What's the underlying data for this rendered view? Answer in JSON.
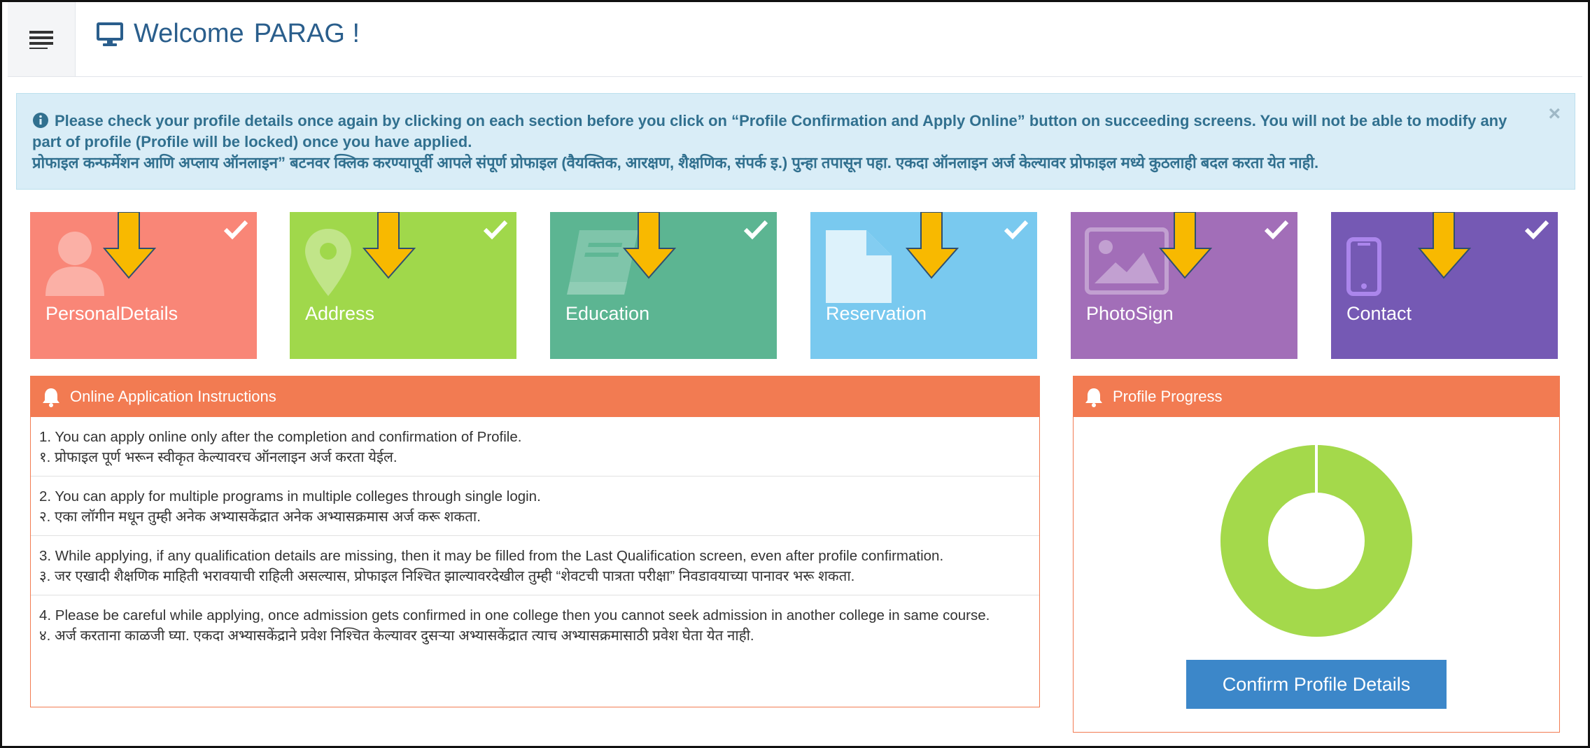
{
  "header": {
    "menu_icon": "hamburger-icon",
    "monitor_icon": "desktop-icon",
    "welcome_prefix": "Welcome",
    "user_name": "PARAG !"
  },
  "alert": {
    "icon": "info-circle-icon",
    "english_text": "Please check your profile details once again by clicking on each section before you click on “Profile Confirmation and Apply Online” button on succeeding screens. You will not be able to modify any part of profile (Profile will be locked) once you have applied.",
    "marathi_text": "प्रोफाइल कन्फर्मेशन आणि अप्लाय ऑनलाइन” बटनवर क्लिक करण्यापूर्वी आपले संपूर्ण प्रोफाइल (वैयक्तिक, आरक्षण, शैक्षणिक, संपर्क इ.) पुन्हा तपासून पहा. एकदा ऑनलाइन अर्ज केल्यावर प्रोफाइल मध्ये कुठलाही बदल करता येत नाही.",
    "close_label": "×"
  },
  "tiles": [
    {
      "label": "PersonalDetails",
      "icon": "user-icon",
      "color": "#f98677",
      "completed": true
    },
    {
      "label": "Address",
      "icon": "map-pin-icon",
      "color": "#a0d84b",
      "completed": true
    },
    {
      "label": "Education",
      "icon": "book-icon",
      "color": "#5cb592",
      "completed": true
    },
    {
      "label": "Reservation",
      "icon": "document-icon",
      "color": "#79c9ef",
      "completed": true
    },
    {
      "label": "PhotoSign",
      "icon": "image-icon",
      "color": "#a26eb8",
      "completed": true
    },
    {
      "label": "Contact",
      "icon": "mobile-phone-icon",
      "color": "#7559b4",
      "completed": true
    }
  ],
  "instructions": {
    "title": "Online Application Instructions",
    "icon": "bell-icon",
    "items": [
      {
        "en": "1. You can apply online only after the completion and confirmation of Profile.",
        "mr": "१. प्रोफाइल पूर्ण भरून स्वीकृत केल्यावरच ऑनलाइन अर्ज करता येईल."
      },
      {
        "en": "2. You can apply for multiple programs in multiple colleges through single login.",
        "mr": "२. एका लॉगीन मधून तुम्ही अनेक अभ्यासकेंद्रात अनेक अभ्यासक्रमास अर्ज करू शकता."
      },
      {
        "en": "3. While applying, if any qualification details are missing, then it may be filled from the Last Qualification screen, even after profile confirmation.",
        "mr": "३. जर एखादी शैक्षणिक माहिती भरावयाची राहिली असल्यास, प्रोफाइल निश्चित झाल्यावरदेखील तुम्ही “शेवटची पात्रता परीक्षा” निवडावयाच्या पानावर भरू शकता."
      },
      {
        "en": "4. Please be careful while applying, once admission gets confirmed in one college then you cannot seek admission in another college in same course.",
        "mr": "४. अर्ज करताना काळजी घ्या. एकदा अभ्यासकेंद्राने प्रवेश निश्चित केल्यावर दुसऱ्या अभ्यासकेंद्रात त्याच अभ्यासक्रमासाठी प्रवेश घेता येत नाही."
      }
    ]
  },
  "progress": {
    "title": "Profile Progress",
    "icon": "bell-icon",
    "percent_complete": 100,
    "ring_color": "#a4d94b",
    "confirm_button_label": "Confirm Profile Details"
  }
}
